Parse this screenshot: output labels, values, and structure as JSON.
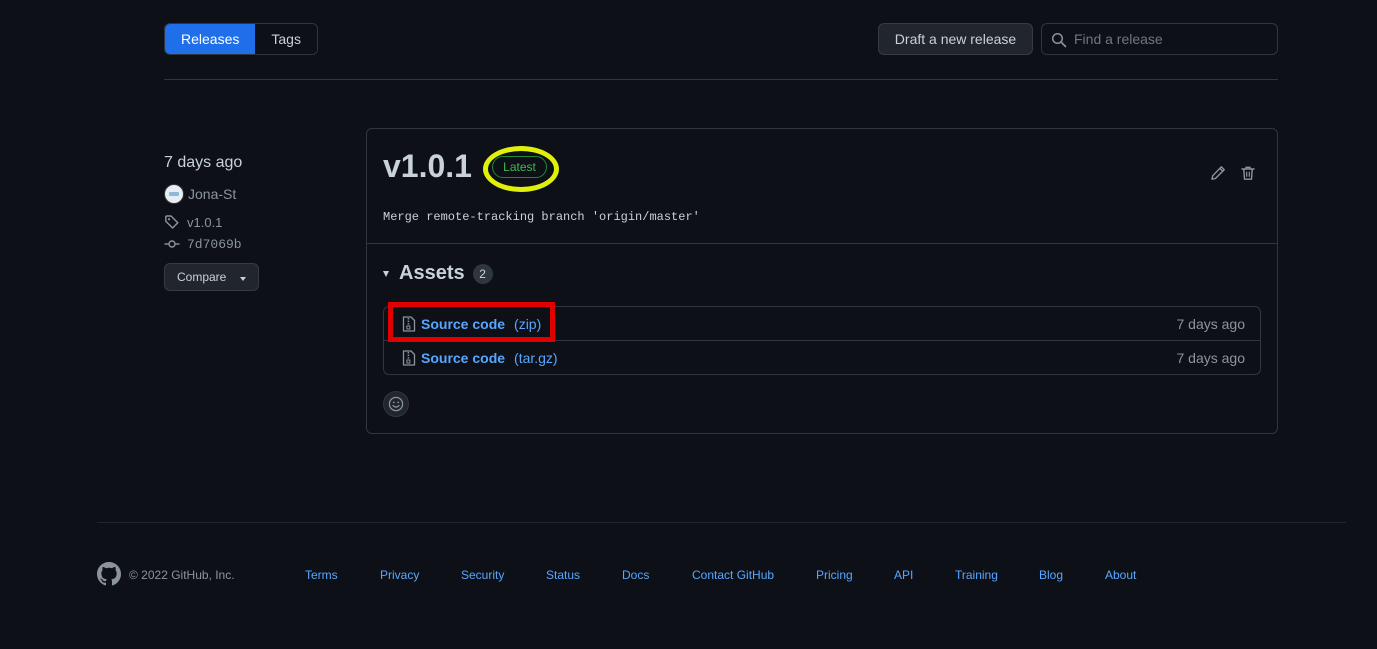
{
  "toolbar": {
    "tabs": [
      {
        "label": "Releases",
        "active": true
      },
      {
        "label": "Tags",
        "active": false
      }
    ],
    "draft_button": "Draft a new release",
    "search_placeholder": "Find a release",
    "search_value": ""
  },
  "release_meta": {
    "date": "7 days ago",
    "author": "Jona-St",
    "tag": "v1.0.1",
    "commit": "7d7069b",
    "compare_label": "Compare"
  },
  "release": {
    "version": "v1.0.1",
    "badge": "Latest",
    "message": "Merge remote-tracking branch 'origin/master'",
    "assets_title": "Assets",
    "assets_count": "2",
    "assets": [
      {
        "name": "Source code",
        "ext": "(zip)",
        "when": "7 days ago"
      },
      {
        "name": "Source code",
        "ext": "(tar.gz)",
        "when": "7 days ago"
      }
    ]
  },
  "footer": {
    "copyright": "© 2022 GitHub, Inc.",
    "links": [
      "Terms",
      "Privacy",
      "Security",
      "Status",
      "Docs",
      "Contact GitHub",
      "Pricing",
      "API",
      "Training",
      "Blog",
      "About"
    ]
  },
  "icons": {
    "search": "search-icon",
    "avatar": "avatar",
    "tag": "tag-icon",
    "commit": "git-commit-icon",
    "edit": "pencil-icon",
    "delete": "trash-icon",
    "zip": "file-zip-icon",
    "emoji": "smiley-icon",
    "logo": "github-mark-icon"
  },
  "colors": {
    "background": "#0d1117",
    "accent": "#1f6feb",
    "link": "#58a6ff",
    "latest_badge": "#3fb950",
    "highlight_circle": "#e0f00b",
    "highlight_box": "#e00000"
  }
}
